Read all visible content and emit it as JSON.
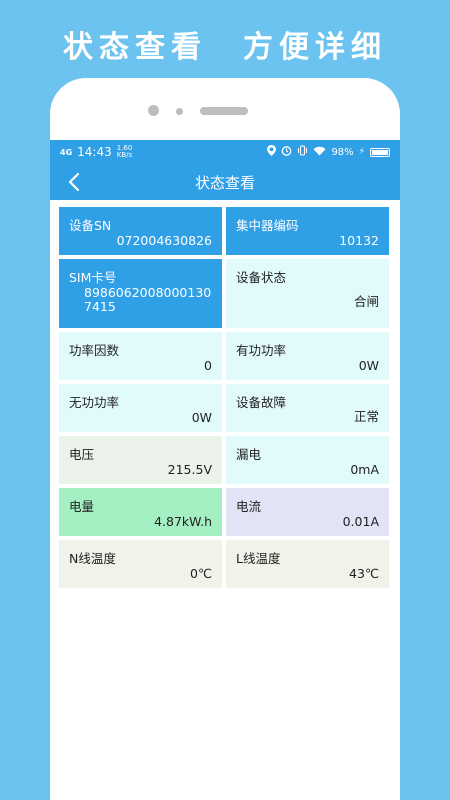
{
  "promo": {
    "title": "状态查看　方便详细"
  },
  "status_bar": {
    "signal": "4G",
    "time": "14:43",
    "net_speed_top": "1.60",
    "net_speed_bottom": "KB/s",
    "battery_pct": "98%",
    "icons": [
      "location-icon",
      "alarm-icon",
      "vibrate-icon",
      "wifi-icon",
      "charging-icon",
      "battery-icon"
    ]
  },
  "nav": {
    "title": "状态查看"
  },
  "cells": [
    {
      "label": "设备SN",
      "value": "072004630826",
      "style": "blue"
    },
    {
      "label": "集中器编码",
      "value": "10132",
      "style": "blue"
    },
    {
      "label": "SIM卡号",
      "value": "89860620080001307415",
      "style": "blue"
    },
    {
      "label": "设备状态",
      "value": "合闸",
      "style": "cyan"
    },
    {
      "label": "功率因数",
      "value": "0",
      "style": "cyan"
    },
    {
      "label": "有功功率",
      "value": "0W",
      "style": "cyan"
    },
    {
      "label": "无功功率",
      "value": "0W",
      "style": "cyan"
    },
    {
      "label": "设备故障",
      "value": "正常",
      "style": "cyan"
    },
    {
      "label": "电压",
      "value": "215.5V",
      "style": "grayg"
    },
    {
      "label": "漏电",
      "value": "0mA",
      "style": "cyan"
    },
    {
      "label": "电量",
      "value": "4.87kW.h",
      "style": "green"
    },
    {
      "label": "电流",
      "value": "0.01A",
      "style": "lav"
    },
    {
      "label": "N线温度",
      "value": "0℃",
      "style": "beige"
    },
    {
      "label": "L线温度",
      "value": "43℃",
      "style": "beige"
    }
  ],
  "colors": {
    "background": "#6cc3f0",
    "accent": "#2f9fe6"
  }
}
